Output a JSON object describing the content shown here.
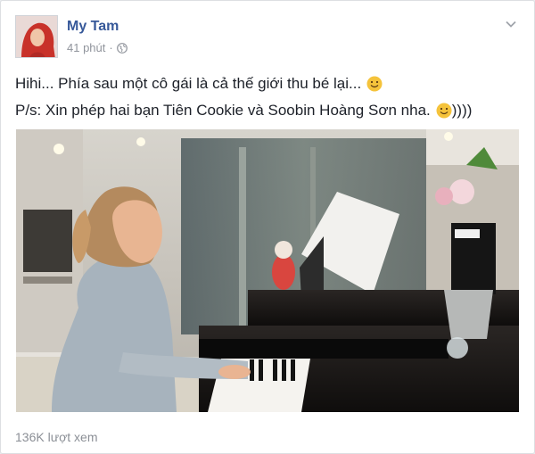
{
  "post": {
    "author": "My Tam",
    "time": "41 phút",
    "dot": "·",
    "lines": [
      "Hihi... Phía sau một cô gái là cả thế giới thu bé lại...",
      "P/s: Xin phép hai bạn Tiên Cookie và Soobin Hoàng Sơn nha."
    ],
    "line2_suffix": "))))",
    "views": "136K lượt xem"
  },
  "icons": {
    "privacy": "globe-icon",
    "menu": "chevron-down-icon",
    "emoji": "smiley-emoji"
  },
  "colors": {
    "author": "#365899",
    "meta": "#90949c",
    "emoji": "#f5c33b"
  }
}
